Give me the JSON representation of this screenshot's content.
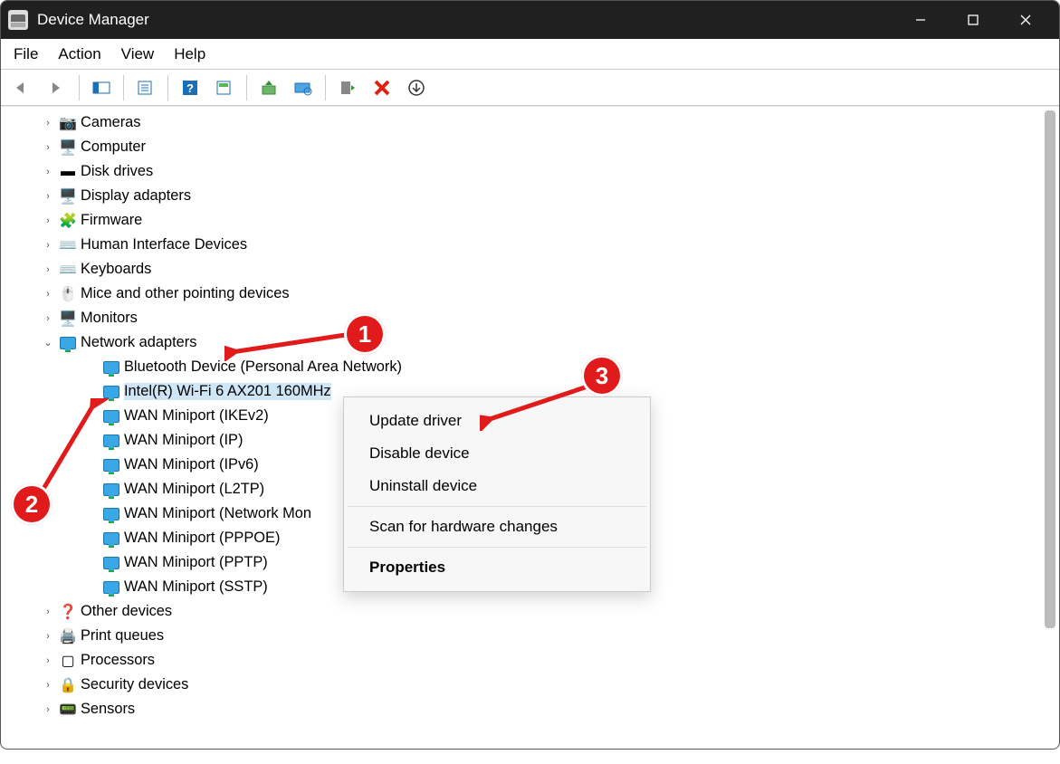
{
  "window": {
    "title": "Device Manager"
  },
  "menu": {
    "items": [
      "File",
      "Action",
      "View",
      "Help"
    ]
  },
  "tree": [
    {
      "label": "Cameras",
      "icon": "📷",
      "expanded": false
    },
    {
      "label": "Computer",
      "icon": "🖥️",
      "expanded": false
    },
    {
      "label": "Disk drives",
      "icon": "▬",
      "expanded": false
    },
    {
      "label": "Display adapters",
      "icon": "🖥️",
      "expanded": false
    },
    {
      "label": "Firmware",
      "icon": "🧩",
      "expanded": false
    },
    {
      "label": "Human Interface Devices",
      "icon": "⌨️",
      "expanded": false
    },
    {
      "label": "Keyboards",
      "icon": "⌨️",
      "expanded": false
    },
    {
      "label": "Mice and other pointing devices",
      "icon": "🖱️",
      "expanded": false
    },
    {
      "label": "Monitors",
      "icon": "🖥️",
      "expanded": false
    },
    {
      "label": "Network adapters",
      "icon": "net",
      "expanded": true,
      "children": [
        {
          "label": "Bluetooth Device (Personal Area Network)"
        },
        {
          "label": "Intel(R) Wi-Fi 6 AX201 160MHz",
          "selected": true
        },
        {
          "label": "WAN Miniport (IKEv2)"
        },
        {
          "label": "WAN Miniport (IP)"
        },
        {
          "label": "WAN Miniport (IPv6)"
        },
        {
          "label": "WAN Miniport (L2TP)"
        },
        {
          "label": "WAN Miniport (Network Mon"
        },
        {
          "label": "WAN Miniport (PPPOE)"
        },
        {
          "label": "WAN Miniport (PPTP)"
        },
        {
          "label": "WAN Miniport (SSTP)"
        }
      ]
    },
    {
      "label": "Other devices",
      "icon": "❓",
      "expanded": false
    },
    {
      "label": "Print queues",
      "icon": "🖨️",
      "expanded": false
    },
    {
      "label": "Processors",
      "icon": "▢",
      "expanded": false
    },
    {
      "label": "Security devices",
      "icon": "🔒",
      "expanded": false
    },
    {
      "label": "Sensors",
      "icon": "📟",
      "expanded": false
    }
  ],
  "contextMenu": {
    "items": [
      {
        "label": "Update driver"
      },
      {
        "label": "Disable device"
      },
      {
        "label": "Uninstall device"
      },
      {
        "sep": true
      },
      {
        "label": "Scan for hardware changes"
      },
      {
        "sep": true
      },
      {
        "label": "Properties",
        "bold": true
      }
    ]
  },
  "annotations": {
    "a1": "1",
    "a2": "2",
    "a3": "3"
  }
}
